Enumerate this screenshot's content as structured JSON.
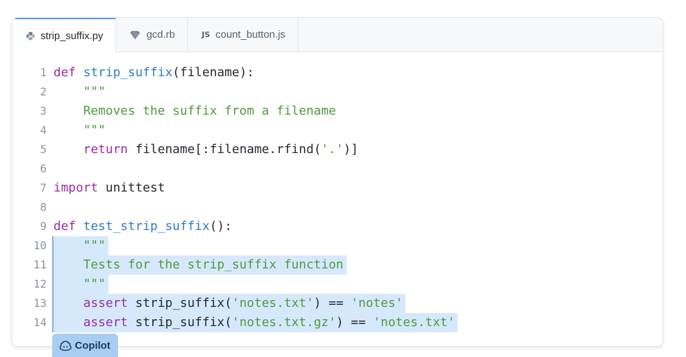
{
  "tabs": [
    {
      "label": "strip_suffix.py",
      "icon": "python-icon"
    },
    {
      "label": "gcd.rb",
      "icon": "ruby-icon"
    },
    {
      "label": "count_button.js",
      "icon": "js-icon",
      "badge": "JS"
    }
  ],
  "code": {
    "lines": [
      {
        "num": "1",
        "parts": [
          {
            "t": "def ",
            "c": "kw"
          },
          {
            "t": "strip_suffix",
            "c": "fn"
          },
          {
            "t": "(filename):",
            "c": "nm"
          }
        ]
      },
      {
        "num": "2",
        "parts": [
          {
            "t": "    \"\"\"",
            "c": "cm"
          }
        ]
      },
      {
        "num": "3",
        "parts": [
          {
            "t": "    Removes the suffix from a filename",
            "c": "cm"
          }
        ]
      },
      {
        "num": "4",
        "parts": [
          {
            "t": "    \"\"\"",
            "c": "cm"
          }
        ]
      },
      {
        "num": "5",
        "parts": [
          {
            "t": "    ",
            "c": "nm"
          },
          {
            "t": "return",
            "c": "kw"
          },
          {
            "t": " filename[:filename.rfind(",
            "c": "nm"
          },
          {
            "t": "'.'",
            "c": "st"
          },
          {
            "t": ")]",
            "c": "nm"
          }
        ]
      },
      {
        "num": "6",
        "parts": []
      },
      {
        "num": "7",
        "parts": [
          {
            "t": "import",
            "c": "kw"
          },
          {
            "t": " unittest",
            "c": "nm"
          }
        ]
      },
      {
        "num": "8",
        "parts": []
      },
      {
        "num": "9",
        "parts": [
          {
            "t": "def ",
            "c": "kw"
          },
          {
            "t": "test_strip_suffix",
            "c": "fn"
          },
          {
            "t": "():",
            "c": "nm"
          }
        ]
      },
      {
        "num": "10",
        "sel": true,
        "parts": [
          {
            "t": "    \"\"\"",
            "c": "cm"
          }
        ]
      },
      {
        "num": "11",
        "sel": true,
        "parts": [
          {
            "t": "    Tests for the strip_suffix function",
            "c": "cm"
          }
        ]
      },
      {
        "num": "12",
        "sel": true,
        "parts": [
          {
            "t": "    \"\"\"",
            "c": "cm"
          }
        ]
      },
      {
        "num": "13",
        "sel": true,
        "parts": [
          {
            "t": "    ",
            "c": "nm"
          },
          {
            "t": "assert",
            "c": "kw"
          },
          {
            "t": " strip_suffix(",
            "c": "nm"
          },
          {
            "t": "'notes.txt'",
            "c": "st"
          },
          {
            "t": ") == ",
            "c": "nm"
          },
          {
            "t": "'notes'",
            "c": "st"
          }
        ]
      },
      {
        "num": "14",
        "sel": true,
        "parts": [
          {
            "t": "    ",
            "c": "nm"
          },
          {
            "t": "assert",
            "c": "kw"
          },
          {
            "t": " strip_suffix(",
            "c": "nm"
          },
          {
            "t": "'notes.txt.gz'",
            "c": "st"
          },
          {
            "t": ") == ",
            "c": "nm"
          },
          {
            "t": "'notes.txt'",
            "c": "st"
          }
        ]
      }
    ]
  },
  "copilot": {
    "label": "Copilot",
    "icon": "copilot-icon"
  },
  "colors": {
    "selection": "#d6e8fb",
    "keyword": "#9a2ca4",
    "function": "#2f7cc6",
    "string": "#4f9a3f"
  }
}
